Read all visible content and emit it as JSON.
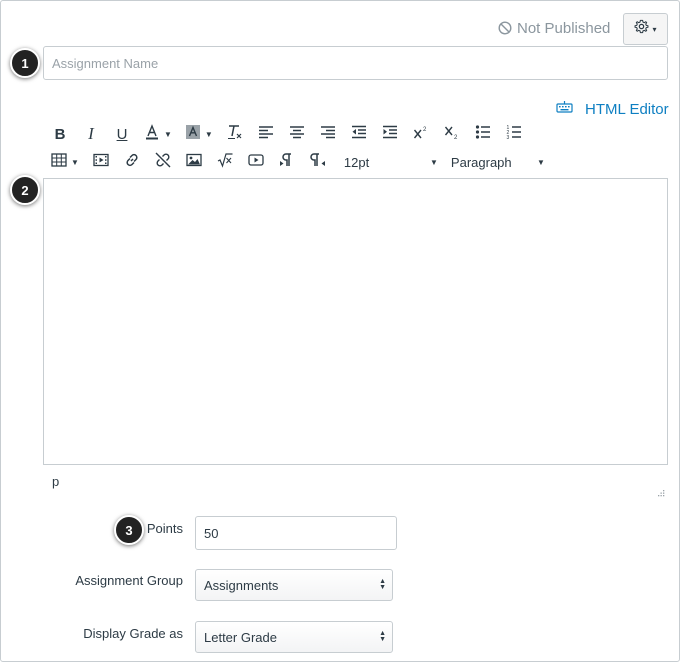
{
  "header": {
    "publish_status": "Not Published",
    "settings_caret": "▾"
  },
  "badges": [
    "1",
    "2",
    "3"
  ],
  "assignment_name": {
    "placeholder": "Assignment Name",
    "value": ""
  },
  "editor": {
    "html_editor_label": "HTML Editor",
    "font_size": "12pt",
    "block_format": "Paragraph",
    "status_path": "p",
    "toolbar_row1": [
      "bold",
      "italic",
      "underline",
      "text-color",
      "background-color",
      "clear-formatting",
      "align-left",
      "align-center",
      "align-right",
      "outdent",
      "indent",
      "superscript",
      "subscript",
      "bullet-list",
      "numbered-list"
    ],
    "toolbar_row2": [
      "table",
      "media",
      "link",
      "unlink",
      "image",
      "equation",
      "embed-video",
      "ltr",
      "rtl",
      "font-size",
      "format"
    ]
  },
  "form": {
    "points_label": "Points",
    "points_value": "50",
    "group_label": "Assignment Group",
    "group_value": "Assignments",
    "display_label": "Display Grade as",
    "display_value": "Letter Grade"
  },
  "colors": {
    "link_blue": "#0e7fc2",
    "text": "#2d3b45",
    "muted": "#8b969e",
    "border": "#c7cdd1",
    "badge": "#222222"
  }
}
